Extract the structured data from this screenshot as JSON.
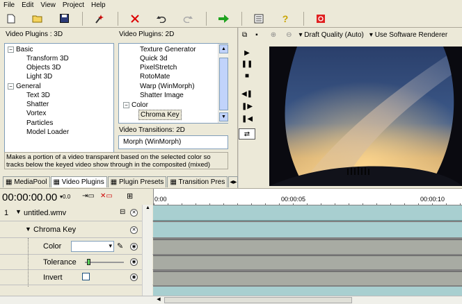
{
  "menu": [
    "File",
    "Edit",
    "View",
    "Project",
    "Help"
  ],
  "toolbar_icons": [
    "new-file-icon",
    "open-folder-icon",
    "save-icon",
    "wand-icon",
    "delete-icon",
    "undo-icon",
    "redo-icon",
    "export-icon",
    "properties-icon",
    "help-icon",
    "record-icon"
  ],
  "plugins3d": {
    "title": "Video Plugins : 3D",
    "groups": [
      {
        "label": "Basic",
        "items": [
          "Transform 3D",
          "Objects 3D",
          "Light 3D"
        ]
      },
      {
        "label": "General",
        "items": [
          "Text 3D",
          "Shatter",
          "Vortex",
          "Particles",
          "Model Loader"
        ]
      }
    ]
  },
  "plugins2d": {
    "title": "Video Plugins: 2D",
    "items": [
      "Texture Generator",
      "Quick 3d",
      "PixelStretch",
      "RotoMate",
      "Warp (WinMorph)",
      "Shatter Image"
    ],
    "group": "Color",
    "group_item": "Chroma Key"
  },
  "transitions": {
    "title": "Video Transitions: 2D",
    "items": [
      "Morph (WinMorph)"
    ]
  },
  "description": "Makes a portion of a video transparent based on the selected color so tracks below the keyed video show through in the composited (mixed) output.",
  "tabs": [
    "MediaPool",
    "Video Plugins",
    "Plugin Presets",
    "Transition Pres"
  ],
  "viewer": {
    "quality": "Draft Quality (Auto)",
    "renderer": "Use Software Renderer"
  },
  "timecode": "00:00:00.00",
  "timecode_small": "0.0",
  "ruler": [
    "0:00",
    "00:00:05",
    "00:00:10"
  ],
  "track": {
    "number": "1",
    "name": "untitled.wmv",
    "effect": "Chroma Key",
    "params": {
      "color_label": "Color",
      "tolerance_label": "Tolerance",
      "tolerance_value": 0.05,
      "invert_label": "Invert"
    }
  }
}
